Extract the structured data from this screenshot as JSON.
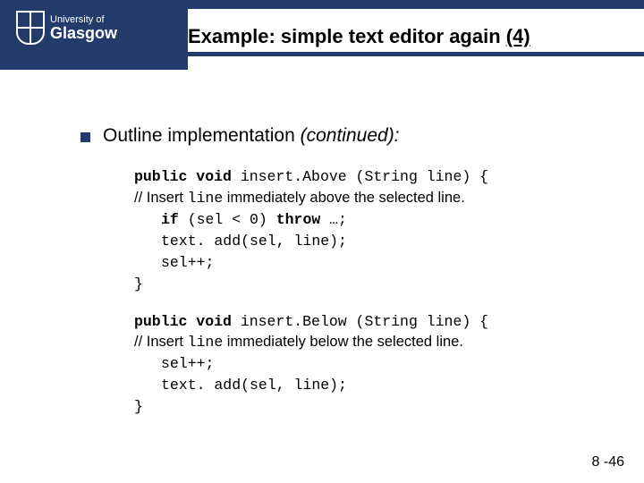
{
  "logo": {
    "line1": "University of",
    "line2": "Glasgow"
  },
  "title": {
    "prefix": "Example: simple text editor again ",
    "suffix": "(4)"
  },
  "bullet": {
    "lead": "Outline implementation ",
    "tail": "(continued):"
  },
  "code1": {
    "sig_pre": "public void",
    "sig_post": " insert.Above (String line) {",
    "cmt_pre": "//  Insert ",
    "cmt_code": "line",
    "cmt_post": " immediately above the selected line.",
    "l1a": "if",
    "l1b": " (sel < 0) ",
    "l1c": "throw",
    "l1d": " …;",
    "l2": "text. add(sel, line);",
    "l3": "sel++;",
    "l4": "}"
  },
  "code2": {
    "sig_pre": "public void",
    "sig_post": " insert.Below (String line) {",
    "cmt_pre": "//  Insert ",
    "cmt_code": "line",
    "cmt_post": " immediately below the selected line.",
    "l1": "sel++;",
    "l2": "text. add(sel, line);",
    "l3": "}"
  },
  "page": "8 -46"
}
